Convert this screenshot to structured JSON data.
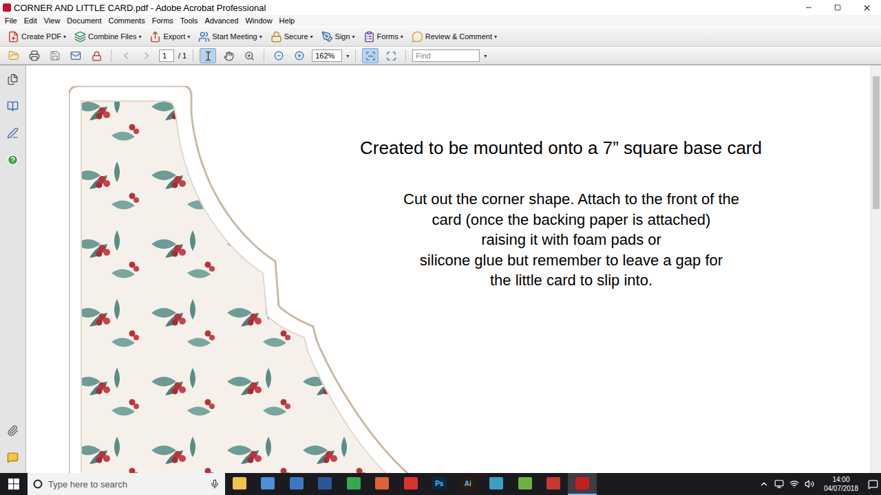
{
  "window": {
    "title": "CORNER AND LITTLE CARD.pdf - Adobe Acrobat Professional"
  },
  "menu": [
    "File",
    "Edit",
    "View",
    "Document",
    "Comments",
    "Forms",
    "Tools",
    "Advanced",
    "Window",
    "Help"
  ],
  "toolbar": [
    {
      "label": "Create PDF",
      "dropdown": "▾"
    },
    {
      "label": "Combine Files",
      "dropdown": "▾"
    },
    {
      "label": "Export",
      "dropdown": "▾"
    },
    {
      "label": "Start Meeting",
      "dropdown": "▾"
    },
    {
      "label": "Secure",
      "dropdown": "▾"
    },
    {
      "label": "Sign",
      "dropdown": "▾"
    },
    {
      "label": "Forms",
      "dropdown": "▾"
    },
    {
      "label": "Review & Comment",
      "dropdown": "▾"
    }
  ],
  "tools": [
    {
      "selected": true
    },
    {
      "selected": false
    },
    {
      "selected": false
    }
  ],
  "view_modes": [
    {
      "selected": true
    },
    {
      "selected": false
    }
  ],
  "navigation": {
    "page": "1",
    "page_count": "/ 1",
    "zoom": "162%",
    "find_placeholder": "Find"
  },
  "document": {
    "heading": "Created to be mounted onto a 7” square base card",
    "instructions": [
      "Cut out the corner shape. Attach to the front of the",
      "card (once the backing paper is attached)",
      "raising it with foam pads or",
      "silicone glue but remember to leave a gap for",
      "the little card to slip into."
    ]
  },
  "taskbar": {
    "search_placeholder": "Type here to search",
    "apps": [
      {
        "label": "",
        "color": "#f2c14e",
        "selected": false
      },
      {
        "label": "",
        "color": "#4a90d9",
        "selected": false
      },
      {
        "label": "",
        "color": "#3b78c4",
        "selected": false
      },
      {
        "label": "",
        "color": "#2b579a",
        "selected": false
      },
      {
        "label": "",
        "color": "#34a853",
        "selected": false
      },
      {
        "label": "",
        "color": "#e0603a",
        "selected": false
      },
      {
        "label": "",
        "color": "#d9342b",
        "selected": false
      },
      {
        "label": "Ps",
        "color": "#0b2940",
        "selected": false
      },
      {
        "label": "Ai",
        "color": "#2d1b0a",
        "selected": false
      },
      {
        "label": "",
        "color": "#3aa0c8",
        "selected": false
      },
      {
        "label": "",
        "color": "#6bb33e",
        "selected": false
      },
      {
        "label": "",
        "color": "#c8372d",
        "selected": false
      },
      {
        "label": "",
        "color": "#c41e1e",
        "selected": true
      }
    ],
    "time": "14:00",
    "date": "04/07/2018"
  }
}
